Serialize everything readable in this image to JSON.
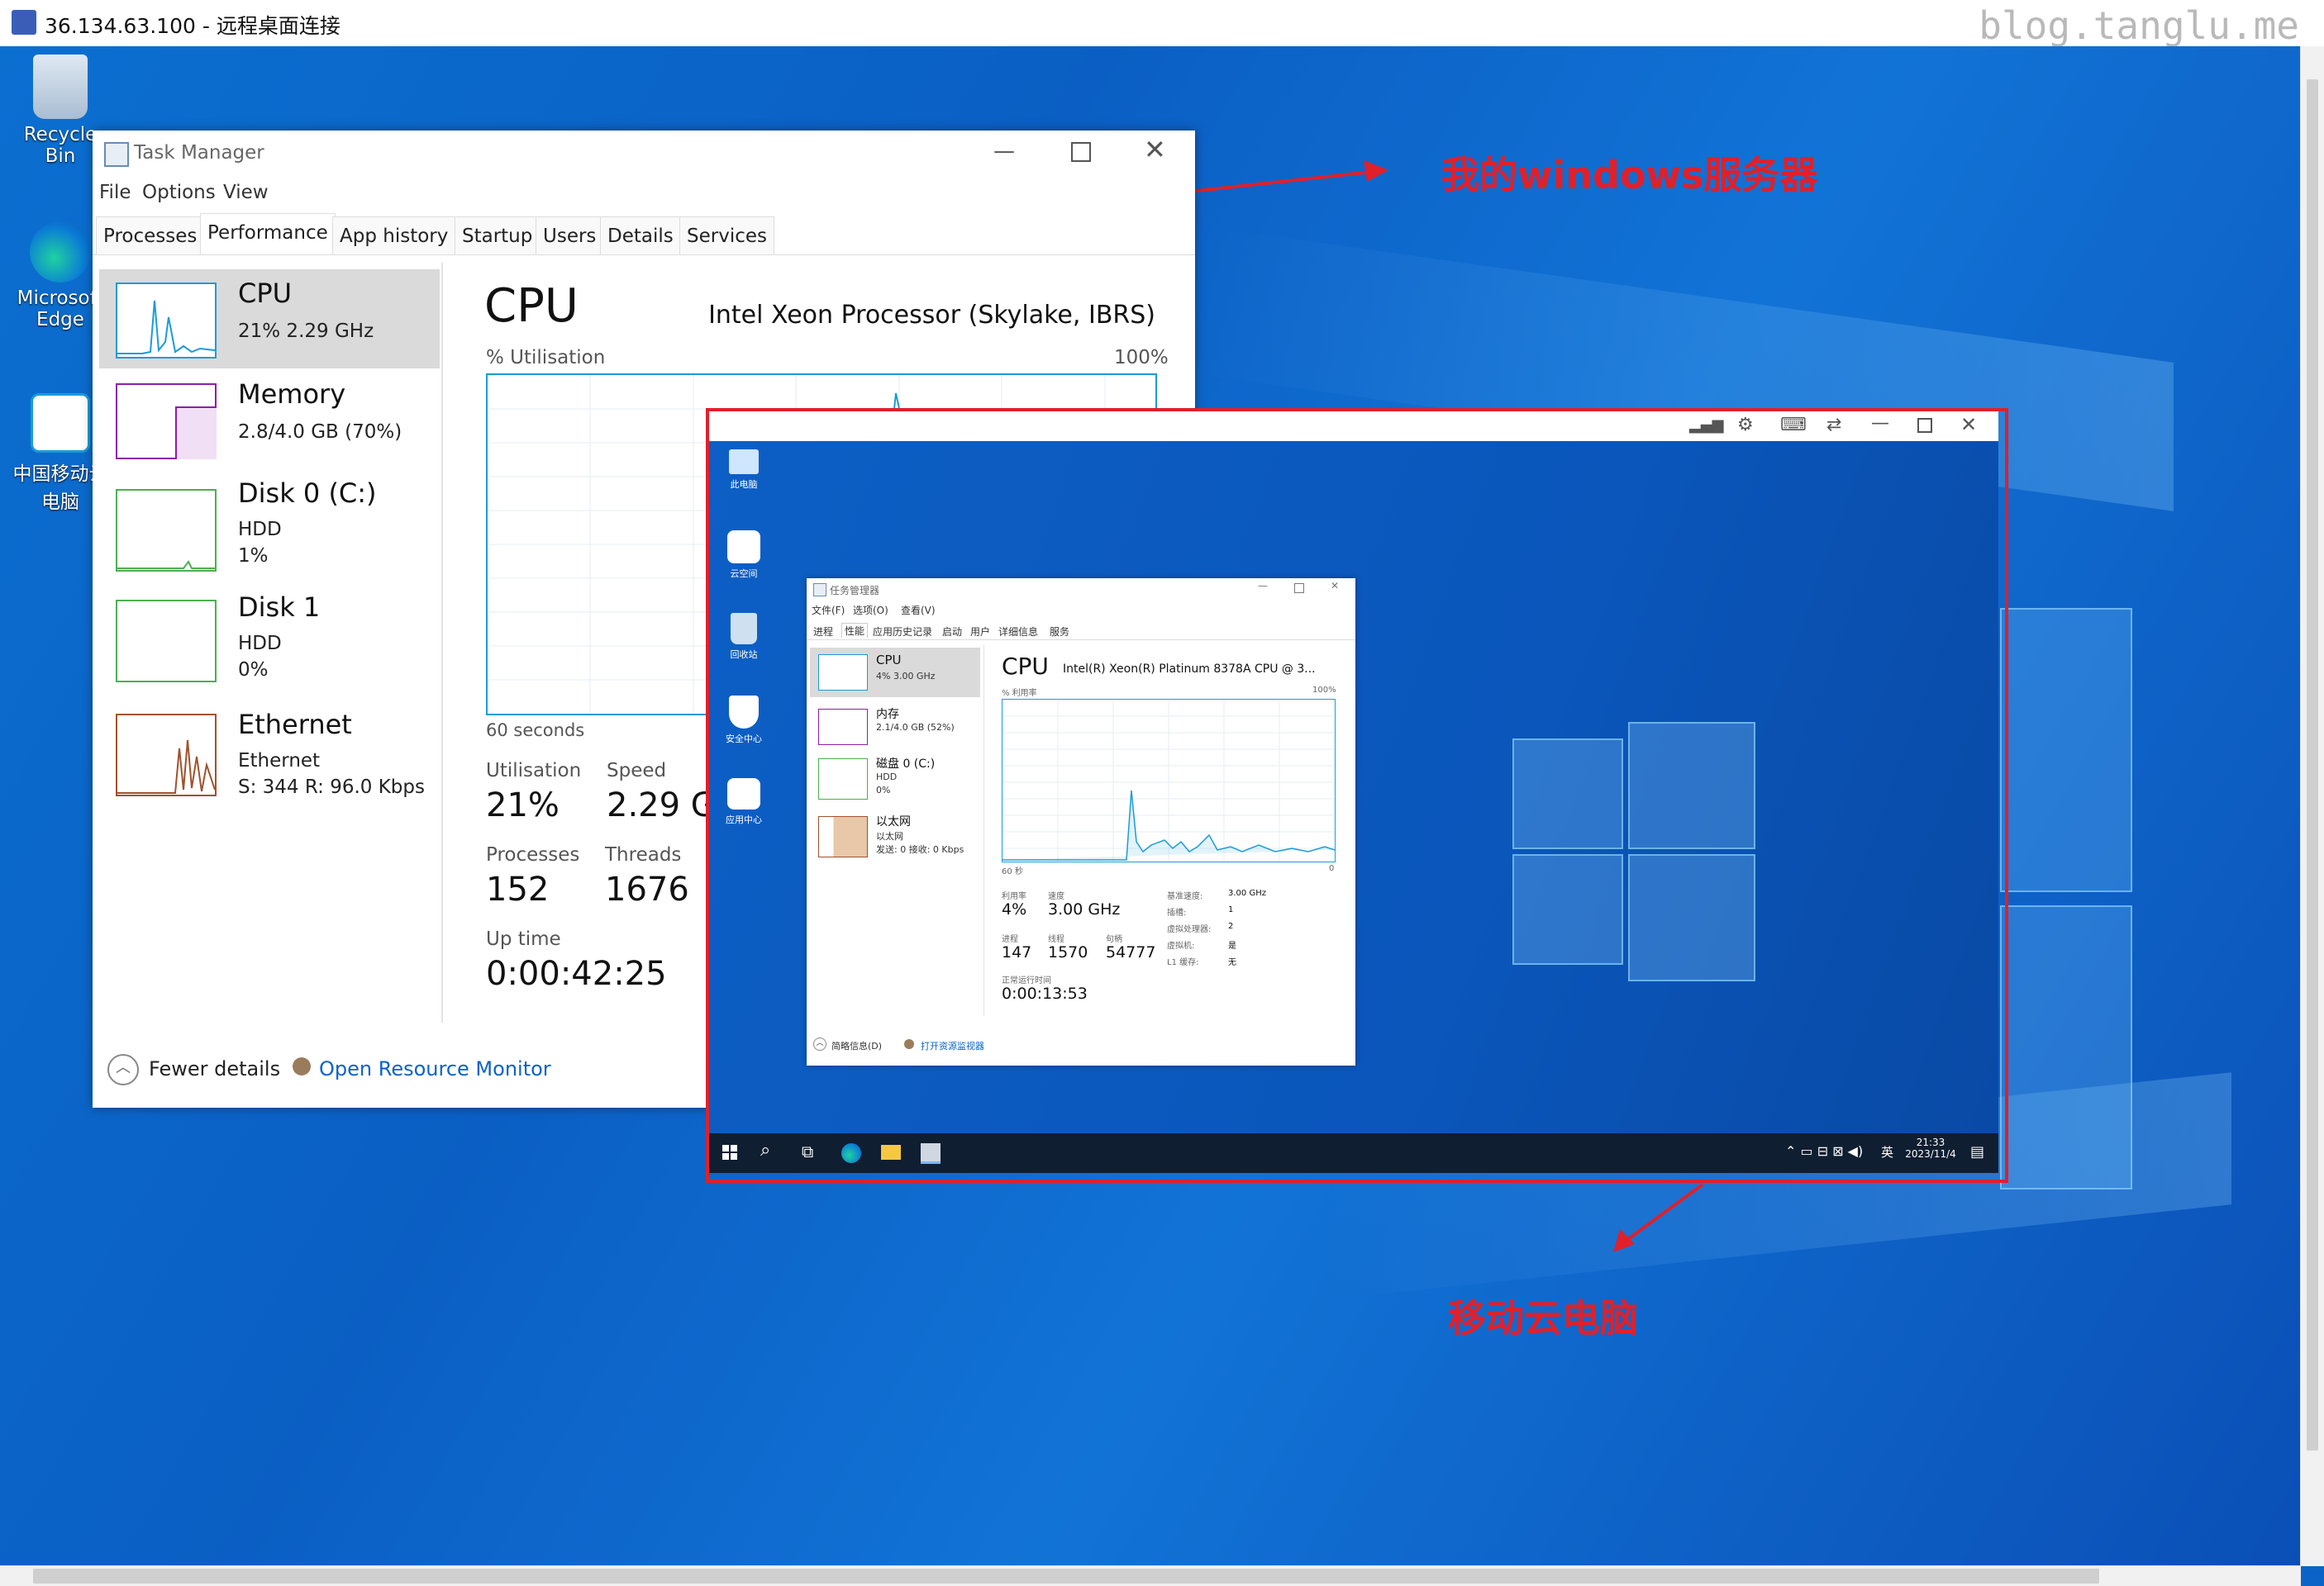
{
  "rdp": {
    "title": "36.134.63.100 - 远程桌面连接",
    "watermark": "blog.tanglu.me"
  },
  "desktop_icons": [
    {
      "label": "Recycle Bin"
    },
    {
      "label": "Microsoft Edge"
    },
    {
      "label": "中国移动云电脑"
    }
  ],
  "annotations": {
    "server": "我的windows服务器",
    "cloud": "移动云电脑"
  },
  "task_manager": {
    "title": "Task Manager",
    "menu": [
      "File",
      "Options",
      "View"
    ],
    "tabs": [
      "Processes",
      "Performance",
      "App history",
      "Startup",
      "Users",
      "Details",
      "Services"
    ],
    "sidebar": [
      {
        "name": "CPU",
        "line1": "21%  2.29 GHz",
        "line2": ""
      },
      {
        "name": "Memory",
        "line1": "2.8/4.0 GB (70%)",
        "line2": ""
      },
      {
        "name": "Disk 0 (C:)",
        "line1": "HDD",
        "line2": "1%"
      },
      {
        "name": "Disk 1",
        "line1": "HDD",
        "line2": "0%"
      },
      {
        "name": "Ethernet",
        "line1": "Ethernet",
        "line2": "S: 344  R: 96.0 Kbps"
      }
    ],
    "main": {
      "heading": "CPU",
      "processor": "Intel Xeon Processor (Skylake, IBRS)",
      "util_label": "% Utilisation",
      "util_max": "100%",
      "time_label": "60 seconds",
      "stats": [
        {
          "label": "Utilisation",
          "value": "21%"
        },
        {
          "label": "Speed",
          "value": "2.29 G"
        },
        {
          "label": "Processes",
          "value": "152"
        },
        {
          "label": "Threads",
          "value": "1676"
        },
        {
          "label": "Up time",
          "value": "0:00:42:25"
        }
      ]
    },
    "footer": {
      "fewer": "Fewer details",
      "monitor": "Open Resource Monitor"
    }
  },
  "cloud_pc": {
    "desktop_icons": [
      "此电脑",
      "云空间",
      "回收站",
      "安全中心",
      "应用中心"
    ],
    "taskbar": {
      "time": "21:33",
      "date": "2023/11/4",
      "ime": "英"
    },
    "task_manager": {
      "title": "任务管理器",
      "menu": [
        "文件(F)",
        "选项(O)",
        "查看(V)"
      ],
      "tabs": [
        "进程",
        "性能",
        "应用历史记录",
        "启动",
        "用户",
        "详细信息",
        "服务"
      ],
      "sidebar": [
        {
          "name": "CPU",
          "line1": "4%  3.00 GHz",
          "line2": ""
        },
        {
          "name": "内存",
          "line1": "2.1/4.0 GB (52%)",
          "line2": ""
        },
        {
          "name": "磁盘 0 (C:)",
          "line1": "HDD",
          "line2": "0%"
        },
        {
          "name": "以太网",
          "line1": "以太网",
          "line2": "发送: 0  接收: 0 Kbps"
        }
      ],
      "heading": "CPU",
      "processor": "Intel(R) Xeon(R) Platinum 8378A CPU @ 3...",
      "util_label": "% 利用率",
      "util_max": "100%",
      "time_label": "60 秒",
      "time_right": "0",
      "stats": [
        {
          "label": "利用率",
          "value": "4%"
        },
        {
          "label": "速度",
          "value": "3.00 GHz"
        },
        {
          "label": "进程",
          "value": "147"
        },
        {
          "label": "线程",
          "value": "1570"
        },
        {
          "label": "句柄",
          "value": "54777"
        },
        {
          "label": "正常运行时间",
          "value": "0:00:13:53"
        }
      ],
      "specs": [
        {
          "k": "基准速度:",
          "v": "3.00 GHz"
        },
        {
          "k": "插槽:",
          "v": "1"
        },
        {
          "k": "虚拟处理器:",
          "v": "2"
        },
        {
          "k": "虚拟机:",
          "v": "是"
        },
        {
          "k": "L1 缓存:",
          "v": "无"
        }
      ],
      "footer": {
        "fewer": "简略信息(D)",
        "monitor": "打开资源监视器"
      }
    }
  },
  "colors": {
    "accent": "#1b9bd8",
    "annotation": "#e0202a",
    "memory": "#8b1fa8",
    "disk": "#4caf50",
    "ethernet": "#a0522d"
  }
}
